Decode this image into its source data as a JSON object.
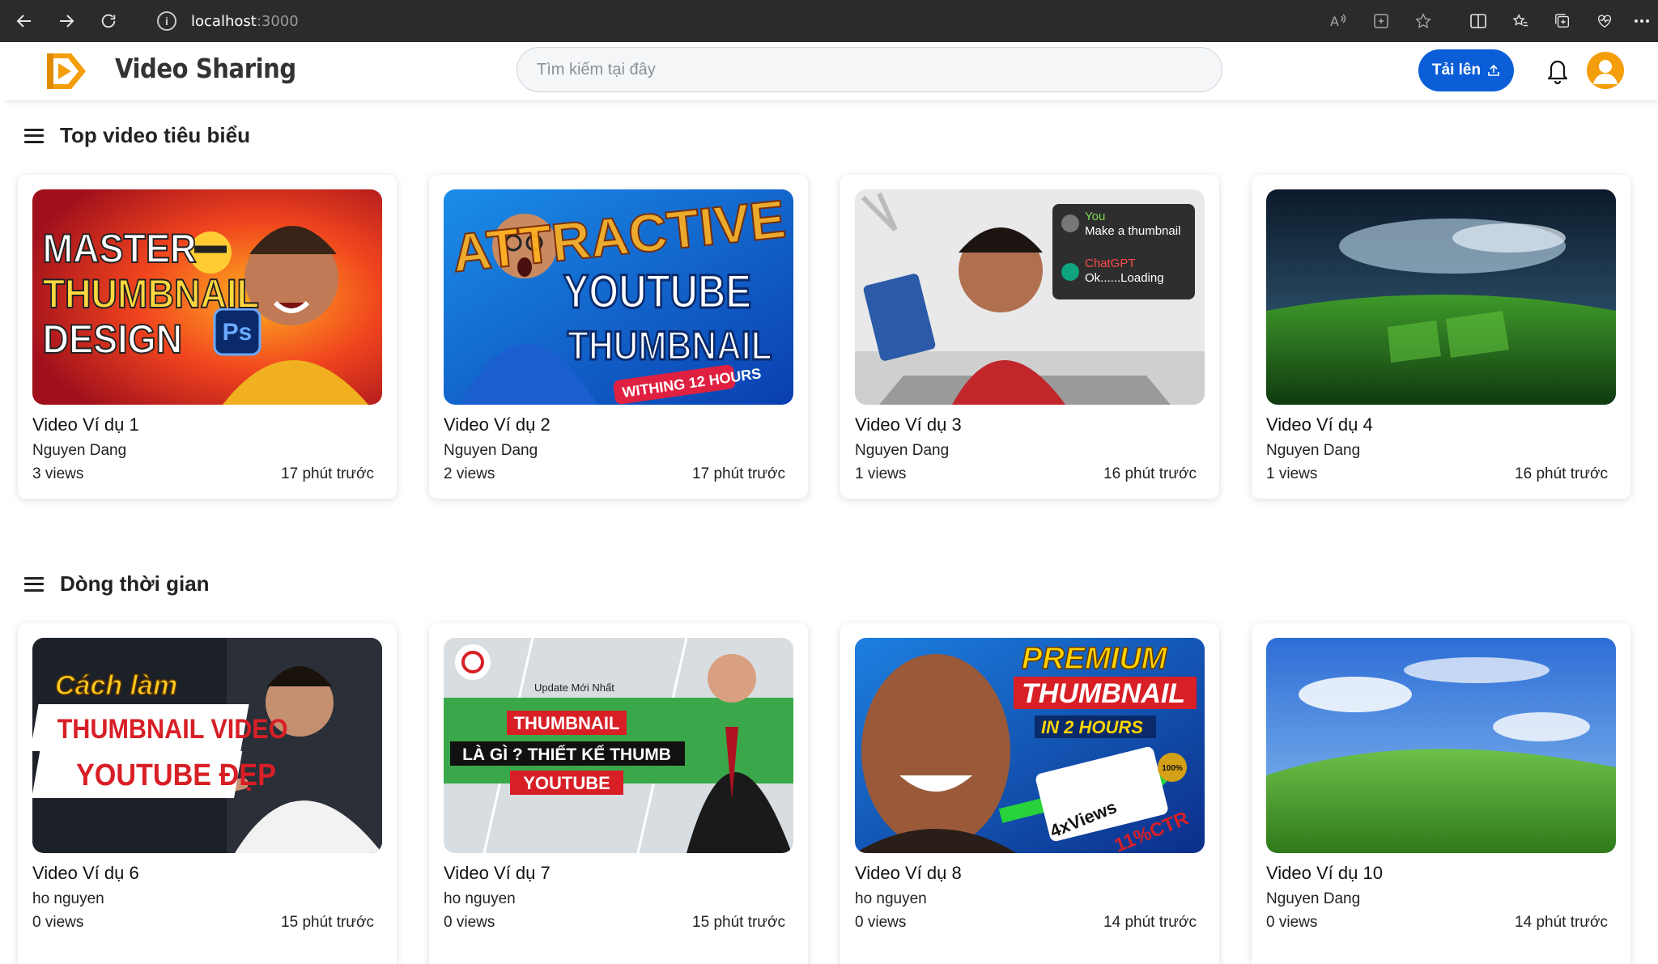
{
  "browser": {
    "url_host": "localhost",
    "url_port": ":3000"
  },
  "header": {
    "brand": "Video Sharing",
    "search_placeholder": "Tìm kiếm tại đây",
    "upload_label": "Tải lên"
  },
  "sections": [
    {
      "title": "Top video tiêu biểu",
      "videos": [
        {
          "title": "Video Ví dụ 1",
          "author": "Nguyen Dang",
          "views": "3 views",
          "time": "17 phút trước",
          "thumb_text": [
            "MASTER",
            "THUMBNAIL",
            "DESIGN"
          ]
        },
        {
          "title": "Video Ví dụ 2",
          "author": "Nguyen Dang",
          "views": "2 views",
          "time": "17 phút trước",
          "thumb_text": [
            "ATTRACTIVE",
            "YOUTUBE",
            "THUMBNAIL",
            "WITHING 12 HOURS"
          ]
        },
        {
          "title": "Video Ví dụ 3",
          "author": "Nguyen Dang",
          "views": "1 views",
          "time": "16 phút trước",
          "thumb_text": [
            "You",
            "Make a thumbnail",
            "ChatGPT",
            "Ok......Loading"
          ]
        },
        {
          "title": "Video Ví dụ 4",
          "author": "Nguyen Dang",
          "views": "1 views",
          "time": "16 phút trước",
          "thumb_text": []
        }
      ]
    },
    {
      "title": "Dòng thời gian",
      "videos": [
        {
          "title": "Video Ví dụ 6",
          "author": "ho nguyen",
          "views": "0 views",
          "time": "15 phút trước",
          "thumb_text": [
            "Cách làm",
            "THUMBNAIL VIDEO",
            "YOUTUBE ĐẸP"
          ]
        },
        {
          "title": "Video Ví dụ 7",
          "author": "ho nguyen",
          "views": "0 views",
          "time": "15 phút trước",
          "thumb_text": [
            "Update Mới Nhất",
            "THUMBNAIL",
            "LÀ GÌ ? THIẾT KẾ THUMB",
            "YOUTUBE"
          ]
        },
        {
          "title": "Video Ví dụ 8",
          "author": "ho nguyen",
          "views": "0 views",
          "time": "14 phút trước",
          "thumb_text": [
            "PREMIUM",
            "THUMBNAIL",
            "IN 2 HOURS",
            "4xViews",
            "11%CTR",
            "100%"
          ]
        },
        {
          "title": "Video Ví dụ 10",
          "author": "Nguyen Dang",
          "views": "0 views",
          "time": "14 phút trước",
          "thumb_text": []
        }
      ]
    }
  ],
  "colors": {
    "accent": "#0b5ed7",
    "avatar": "#f59e0b",
    "logo_orange": "#f59e0b"
  }
}
